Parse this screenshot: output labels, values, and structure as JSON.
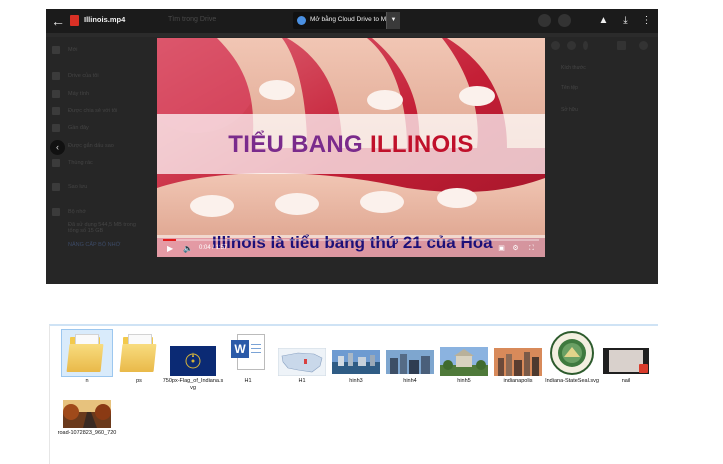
{
  "viewer": {
    "file_name": "Illinois.mp4",
    "search_placeholder": "Tìm trong Drive",
    "open_with_label": "Mở bằng Cloud Drive to Mail",
    "sidebar": [
      {
        "label": "Mới"
      },
      {
        "label": "Drive của tôi"
      },
      {
        "label": "Máy tính"
      },
      {
        "label": "Được chia sẻ với tôi"
      },
      {
        "label": "Gần đây"
      },
      {
        "label": "Được gắn dấu sao"
      },
      {
        "label": "Thùng rác"
      },
      {
        "label": "Sao lưu"
      },
      {
        "label": "Bộ nhớ"
      },
      {
        "label": "Đã sử dụng 544,5 MB trong tổng số 15 GB"
      },
      {
        "label": "NÂNG CẤP BỘ NHỚ"
      }
    ],
    "right_panel": [
      "Kích thước",
      "Tên tệp",
      "Sở hữu"
    ],
    "video": {
      "title_word1": "TIỂU BANG",
      "title_word2": "ILLINOIS",
      "subtitle": "Illinois là tiểu bang thứ 21 của Hoa",
      "time": "0:04 / 1:57",
      "progress": 0.035
    }
  },
  "explorer": {
    "items": [
      {
        "label": "n",
        "kind": "folder"
      },
      {
        "label": "ps",
        "kind": "folder"
      },
      {
        "label": "750px-Flag_of_Indiana.svg",
        "kind": "flag"
      },
      {
        "label": "H1",
        "kind": "word"
      },
      {
        "label": "H1",
        "kind": "map"
      },
      {
        "label": "hinh3",
        "kind": "city"
      },
      {
        "label": "hinh4",
        "kind": "city"
      },
      {
        "label": "hinh5",
        "kind": "city"
      },
      {
        "label": "indianapolis",
        "kind": "city"
      },
      {
        "label": "Indiana-StateSeal.svg",
        "kind": "seal"
      },
      {
        "label": "nail",
        "kind": "video"
      },
      {
        "label": "road-1072823_960_720",
        "kind": "photo"
      }
    ]
  }
}
